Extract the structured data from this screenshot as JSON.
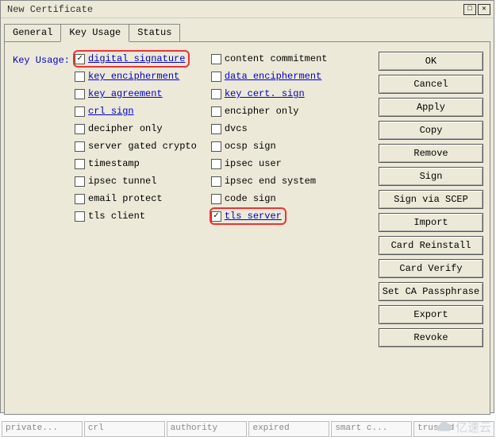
{
  "window": {
    "title": "New Certificate"
  },
  "titlebar_icons": {
    "max": "□",
    "close": "✕"
  },
  "tabs": {
    "general": "General",
    "key_usage": "Key Usage",
    "status": "Status",
    "active": "Key Usage"
  },
  "label": {
    "key_usage": "Key Usage:"
  },
  "col1": [
    {
      "label": "digital signature",
      "checked": true,
      "link": true,
      "hl": true
    },
    {
      "label": "key encipherment",
      "checked": false,
      "link": true,
      "hl": false
    },
    {
      "label": "key agreement",
      "checked": false,
      "link": true,
      "hl": false
    },
    {
      "label": "crl sign",
      "checked": false,
      "link": true,
      "hl": false
    },
    {
      "label": "decipher only",
      "checked": false,
      "link": false,
      "hl": false
    },
    {
      "label": "server gated crypto",
      "checked": false,
      "link": false,
      "hl": false
    },
    {
      "label": "timestamp",
      "checked": false,
      "link": false,
      "hl": false
    },
    {
      "label": "ipsec tunnel",
      "checked": false,
      "link": false,
      "hl": false
    },
    {
      "label": "email protect",
      "checked": false,
      "link": false,
      "hl": false
    },
    {
      "label": "tls client",
      "checked": false,
      "link": false,
      "hl": false
    }
  ],
  "col2": [
    {
      "label": "content commitment",
      "checked": false,
      "link": false,
      "hl": false
    },
    {
      "label": "data encipherment",
      "checked": false,
      "link": true,
      "hl": false
    },
    {
      "label": "key cert. sign",
      "checked": false,
      "link": true,
      "hl": false
    },
    {
      "label": "encipher only",
      "checked": false,
      "link": false,
      "hl": false
    },
    {
      "label": "dvcs",
      "checked": false,
      "link": false,
      "hl": false
    },
    {
      "label": "ocsp sign",
      "checked": false,
      "link": false,
      "hl": false
    },
    {
      "label": "ipsec user",
      "checked": false,
      "link": false,
      "hl": false
    },
    {
      "label": "ipsec end system",
      "checked": false,
      "link": false,
      "hl": false
    },
    {
      "label": "code sign",
      "checked": false,
      "link": false,
      "hl": false
    },
    {
      "label": "tls server",
      "checked": true,
      "link": true,
      "hl": true
    }
  ],
  "buttons": {
    "ok": "OK",
    "cancel": "Cancel",
    "apply": "Apply",
    "copy": "Copy",
    "remove": "Remove",
    "sign": "Sign",
    "sign_scep": "Sign via SCEP",
    "import": "Import",
    "card_reinstall": "Card Reinstall",
    "card_verify": "Card Verify",
    "set_ca_pass": "Set CA Passphrase",
    "export": "Export",
    "revoke": "Revoke"
  },
  "status": {
    "private": "private...",
    "crl": "crl",
    "authority": "authority",
    "expired": "expired",
    "smart": "smart c...",
    "trusted": "trusted"
  },
  "watermark": "亿速云"
}
